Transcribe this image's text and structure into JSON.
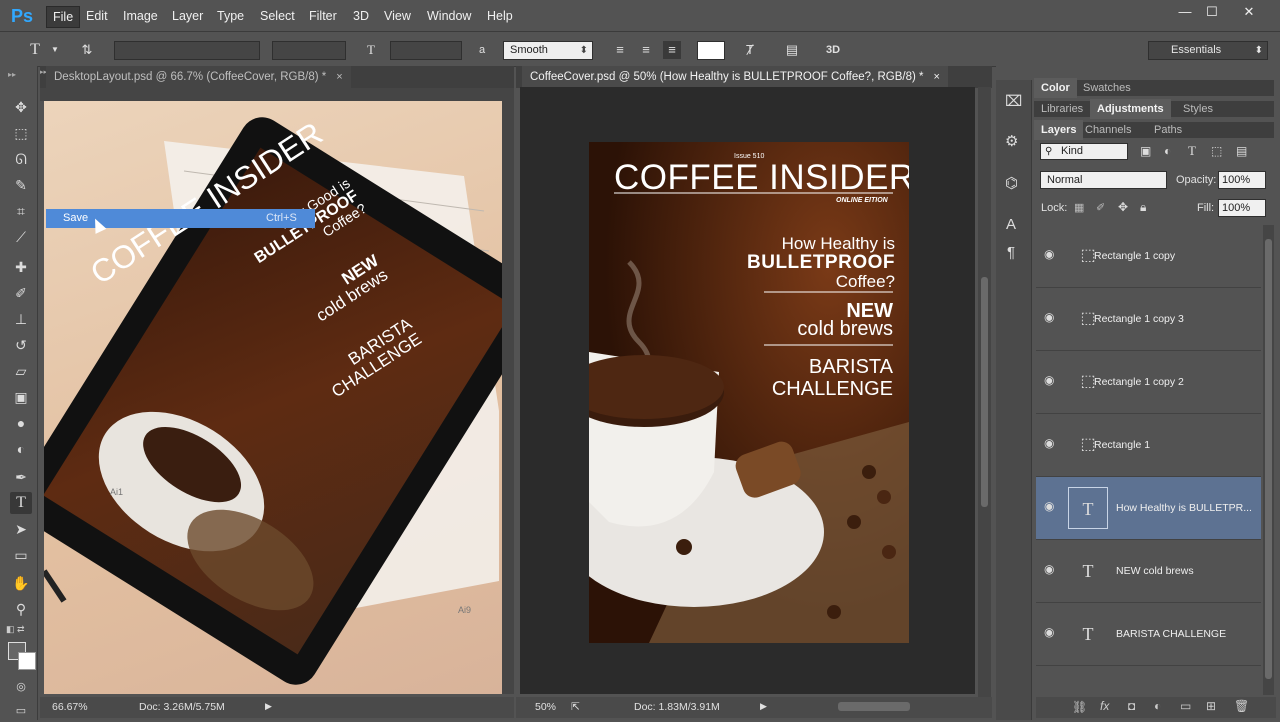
{
  "app": {
    "logo": "Ps"
  },
  "menu": [
    "File",
    "Edit",
    "Image",
    "Layer",
    "Type",
    "Select",
    "Filter",
    "3D",
    "View",
    "Window",
    "Help"
  ],
  "window_controls": {
    "minimize": "—",
    "maximize": "☐",
    "close": "✕"
  },
  "options": {
    "antialias": "Smooth",
    "workspace": "Essentials",
    "type_icon": "T",
    "aa_label": "a",
    "threed": "3D"
  },
  "tabs": [
    {
      "label": "DesktopLayout.psd @ 66.7% (CoffeeCover, RGB/8) *",
      "close": "×"
    },
    {
      "label": "CoffeeCover.psd @ 50% (How Healthy is BULLETPROOF Coffee?, RGB/8) *",
      "close": "×"
    }
  ],
  "context_menu": {
    "item": "Save",
    "shortcut": "Ctrl+S"
  },
  "cover": {
    "issue": "Issue 510",
    "title": "COFFEE INSIDER",
    "subtitle": "ONLINE EITION",
    "headline1_a": "How Healthy is",
    "headline1_b": "BULLETPROOF",
    "headline1_c": "Coffee?",
    "headline2_a": "NEW",
    "headline2_b": "cold brews",
    "headline3_a": "BARISTA",
    "headline3_b": "CHALLENGE"
  },
  "tablet_cover": {
    "title": "COFFEE INSIDER",
    "h1a": "How Good is",
    "h1b": "BULLETPROOF",
    "h1c": "Coffee?",
    "h2a": "NEW",
    "h2b": "cold brews",
    "h3a": "BARISTA",
    "h3b": "CHALLENGE",
    "paper1": "Ai1",
    "paper2": "Ai9"
  },
  "status_left": {
    "zoom": "66.67%",
    "doc": "Doc: 3.26M/5.75M"
  },
  "status_right": {
    "zoom": "50%",
    "doc": "Doc: 1.83M/3.91M"
  },
  "panels": {
    "row1": [
      "Color",
      "Swatches"
    ],
    "row2": [
      "Libraries",
      "Adjustments",
      "Styles"
    ],
    "row3": [
      "Layers",
      "Channels",
      "Paths"
    ],
    "filter": "Kind",
    "blend": "Normal",
    "opacity_label": "Opacity:",
    "opacity": "100%",
    "lock_label": "Lock:",
    "fill_label": "Fill:",
    "fill": "100%"
  },
  "layers": [
    {
      "name": "Rectangle 1 copy",
      "kind": "shape"
    },
    {
      "name": "Rectangle 1 copy 3",
      "kind": "shape"
    },
    {
      "name": "Rectangle 1 copy 2",
      "kind": "shape"
    },
    {
      "name": "Rectangle 1",
      "kind": "shape"
    },
    {
      "name": "How Healthy is BULLETPR...",
      "kind": "type",
      "selected": true
    },
    {
      "name": "NEW cold brews",
      "kind": "type"
    },
    {
      "name": "BARISTA CHALLENGE",
      "kind": "type"
    }
  ],
  "icons": {
    "eye": "👁",
    "shape": "⬚",
    "type": "T"
  },
  "colors": {
    "ui_bg": "#535353",
    "selection": "#5d7292",
    "menu_highlight": "#4f8ad8",
    "ps_blue": "#31a8ff"
  }
}
